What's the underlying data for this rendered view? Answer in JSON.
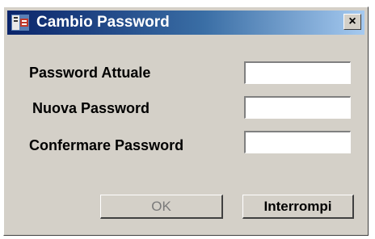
{
  "window": {
    "title": "Cambio Password",
    "close_label": "×"
  },
  "form": {
    "current_password_label": "Password Attuale",
    "new_password_label": "Nuova Password",
    "confirm_password_label": "Confermare Password",
    "current_password_value": "",
    "new_password_value": "",
    "confirm_password_value": ""
  },
  "buttons": {
    "ok_label": "OK",
    "ok_enabled": false,
    "cancel_label": "Interrompi"
  },
  "colors": {
    "titlebar_start": "#0a246a",
    "titlebar_end": "#a6caf0",
    "window_bg": "#d4d0c8"
  },
  "icons": {
    "app": "app-icon",
    "close": "close-icon"
  }
}
